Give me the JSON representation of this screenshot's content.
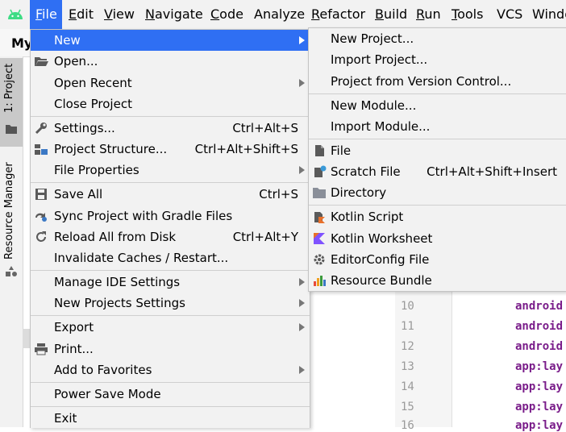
{
  "menubar": {
    "items": [
      {
        "label": "File",
        "mnemonic": "F",
        "rest": "ile"
      },
      {
        "label": "Edit",
        "mnemonic": "E",
        "rest": "dit"
      },
      {
        "label": "View",
        "mnemonic": "V",
        "rest": "iew"
      },
      {
        "label": "Navigate",
        "mnemonic": "N",
        "rest": "avigate"
      },
      {
        "label": "Code",
        "mnemonic": "C",
        "rest": "ode"
      },
      {
        "label": "Analyze",
        "mnemonic": "",
        "rest": "Analyze"
      },
      {
        "label": "Refactor",
        "mnemonic": "R",
        "rest": "efactor"
      },
      {
        "label": "Build",
        "mnemonic": "B",
        "rest": "uild"
      },
      {
        "label": "Run",
        "mnemonic": "R",
        "rest": "un"
      },
      {
        "label": "Tools",
        "mnemonic": "T",
        "rest": "ools"
      },
      {
        "label": "VCS",
        "mnemonic": "",
        "rest": "VCS"
      },
      {
        "label": "Windo",
        "mnemonic": "",
        "rest": "Windo"
      }
    ]
  },
  "navbar": {
    "title": "My"
  },
  "sidebar": {
    "project_tab": "1: Project",
    "resource_tab": "Resource Manager"
  },
  "file_menu": {
    "items": [
      {
        "label": "New",
        "shortcut": ""
      },
      {
        "label": "Open...",
        "shortcut": ""
      },
      {
        "label": "Open Recent",
        "shortcut": ""
      },
      {
        "label": "Close Project",
        "shortcut": ""
      },
      {
        "label": "Settings...",
        "shortcut": "Ctrl+Alt+S"
      },
      {
        "label": "Project Structure...",
        "shortcut": "Ctrl+Alt+Shift+S"
      },
      {
        "label": "File Properties",
        "shortcut": ""
      },
      {
        "label": "Save All",
        "shortcut": "Ctrl+S"
      },
      {
        "label": "Sync Project with Gradle Files",
        "shortcut": ""
      },
      {
        "label": "Reload All from Disk",
        "shortcut": "Ctrl+Alt+Y"
      },
      {
        "label": "Invalidate Caches / Restart...",
        "shortcut": ""
      },
      {
        "label": "Manage IDE Settings",
        "shortcut": ""
      },
      {
        "label": "New Projects Settings",
        "shortcut": ""
      },
      {
        "label": "Export",
        "shortcut": ""
      },
      {
        "label": "Print...",
        "shortcut": ""
      },
      {
        "label": "Add to Favorites",
        "shortcut": ""
      },
      {
        "label": "Power Save Mode",
        "shortcut": ""
      },
      {
        "label": "Exit",
        "shortcut": ""
      }
    ]
  },
  "new_menu": {
    "items": [
      {
        "label": "New Project...",
        "shortcut": ""
      },
      {
        "label": "Import Project...",
        "shortcut": ""
      },
      {
        "label": "Project from Version Control...",
        "shortcut": ""
      },
      {
        "label": "New Module...",
        "shortcut": ""
      },
      {
        "label": "Import Module...",
        "shortcut": ""
      },
      {
        "label": "File",
        "shortcut": ""
      },
      {
        "label": "Scratch File",
        "shortcut": "Ctrl+Alt+Shift+Insert"
      },
      {
        "label": "Directory",
        "shortcut": ""
      },
      {
        "label": "Kotlin Script",
        "shortcut": ""
      },
      {
        "label": "Kotlin Worksheet",
        "shortcut": ""
      },
      {
        "label": "EditorConfig File",
        "shortcut": ""
      },
      {
        "label": "Resource Bundle",
        "shortcut": ""
      }
    ]
  },
  "editor": {
    "line_numbers": [
      "10",
      "11",
      "12",
      "13",
      "14",
      "15",
      "16"
    ],
    "lines": [
      "android",
      "android",
      "android",
      "app:lay",
      "app:lay",
      "app:lay",
      "app:lay"
    ]
  },
  "colors": {
    "accent": "#2f6ff3",
    "menu_bg": "#f2f2f2",
    "keyword": "#7a1d8a"
  },
  "icons": [
    "android-logo-icon",
    "open-folder-icon",
    "wrench-icon",
    "project-structure-icon",
    "save-icon",
    "gradle-sync-icon",
    "reload-icon",
    "printer-icon",
    "file-icon",
    "scratch-file-icon",
    "folder-icon",
    "kotlin-icon",
    "gear-icon",
    "resource-bundle-icon",
    "submenu-arrow-icon"
  ]
}
